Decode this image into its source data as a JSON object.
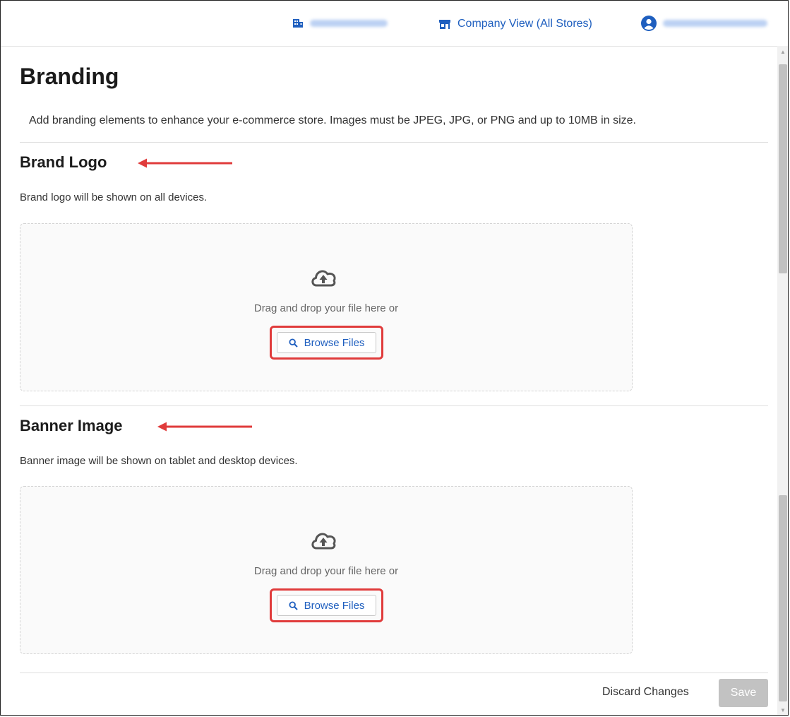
{
  "topbar": {
    "company_view": "Company View (All Stores)",
    "store_icon": "building-icon",
    "company_icon": "storefront-icon",
    "user_icon": "user-circle-icon",
    "accent": "#1f5fbf"
  },
  "page": {
    "title": "Branding",
    "description": "Add branding elements to enhance your e-commerce store. Images must be JPEG, JPG, or PNG and up to 10MB in size."
  },
  "sections": [
    {
      "title": "Brand Logo",
      "description": "Brand logo will be shown on all devices.",
      "dropzone_text": "Drag and drop your file here or",
      "browse_label": "Browse Files"
    },
    {
      "title": "Banner Image",
      "description": "Banner image will be shown on tablet and desktop devices.",
      "dropzone_text": "Drag and drop your file here or",
      "browse_label": "Browse Files"
    }
  ],
  "footer": {
    "discard_label": "Discard Changes",
    "save_label": "Save"
  },
  "annotation_color": "#e03b3b"
}
